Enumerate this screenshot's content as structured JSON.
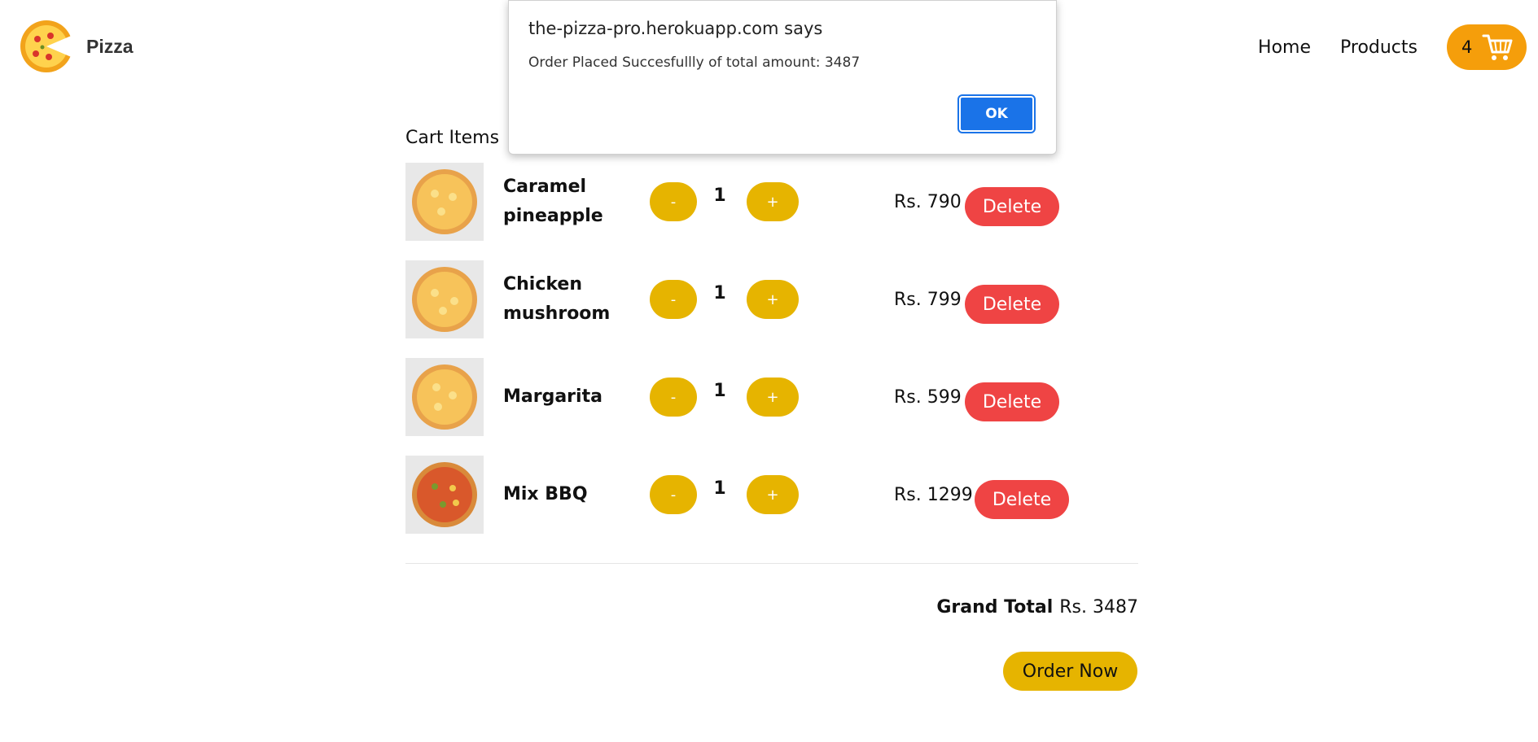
{
  "header": {
    "brand": "Pizza",
    "nav": [
      "Home",
      "Products"
    ],
    "cart_count": "4"
  },
  "cart": {
    "title": "Cart Items",
    "items": [
      {
        "name": "Caramel pineapple",
        "qty": "1",
        "price": "Rs. 790",
        "minus": "-",
        "plus": "+",
        "delete": "Delete"
      },
      {
        "name": "Chicken mushroom",
        "qty": "1",
        "price": "Rs. 799",
        "minus": "-",
        "plus": "+",
        "delete": "Delete"
      },
      {
        "name": "Margarita",
        "qty": "1",
        "price": "Rs. 599",
        "minus": "-",
        "plus": "+",
        "delete": "Delete"
      },
      {
        "name": "Mix BBQ",
        "qty": "1",
        "price": "Rs. 1299",
        "minus": "-",
        "plus": "+",
        "delete": "Delete"
      }
    ],
    "grand_total_label": "Grand Total",
    "grand_total_value": "Rs. 3487",
    "order_button": "Order Now"
  },
  "dialog": {
    "title": "the-pizza-pro.herokuapp.com says",
    "message": "Order Placed Succesfullly of total amount: 3487",
    "ok": "OK"
  },
  "colors": {
    "accent_yellow": "#e6b400",
    "cart_orange": "#f59e0b",
    "delete_red": "#ef4444",
    "dialog_blue": "#1a73e8"
  }
}
